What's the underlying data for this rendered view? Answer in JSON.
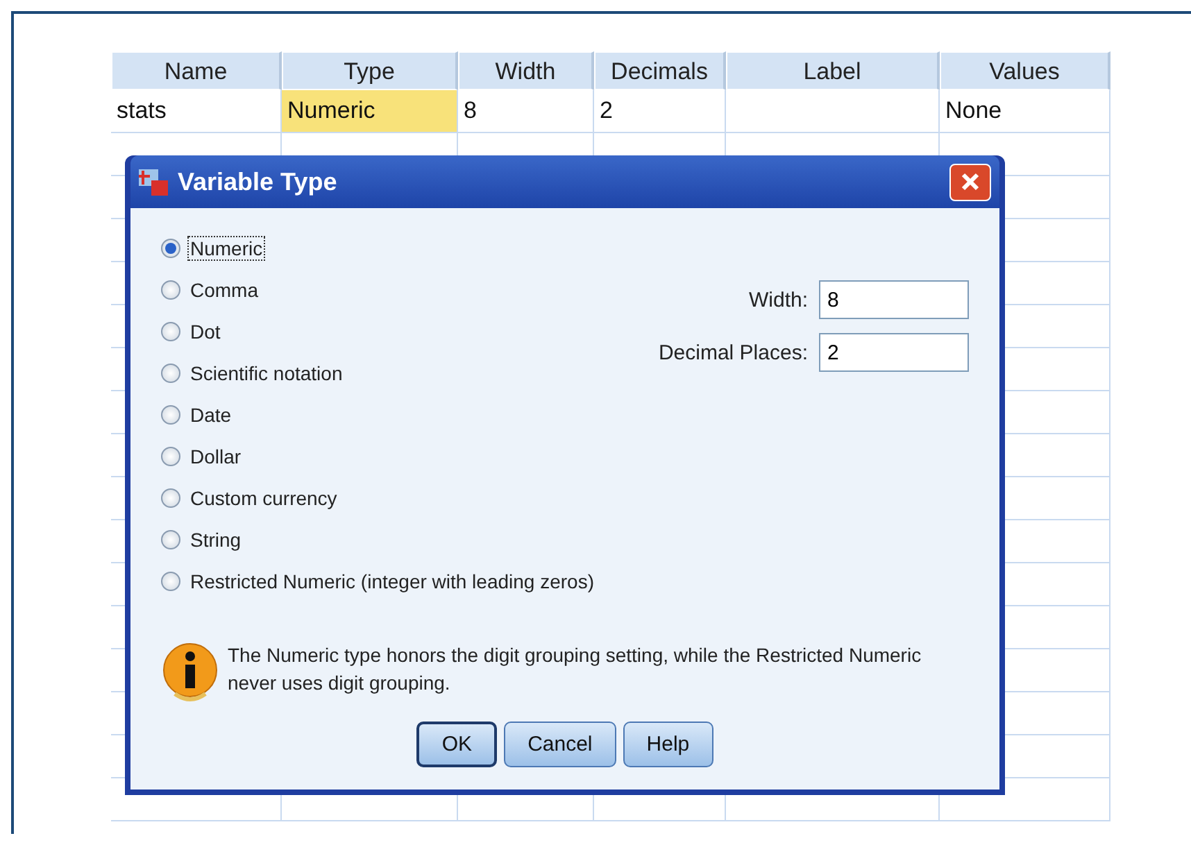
{
  "grid": {
    "columns": [
      "Name",
      "Type",
      "Width",
      "Decimals",
      "Label",
      "Values"
    ],
    "rows": [
      {
        "cells": [
          {
            "text": "stats",
            "selected": false
          },
          {
            "text": "Numeric",
            "selected": true
          },
          {
            "text": "8",
            "selected": false
          },
          {
            "text": "2",
            "selected": false
          },
          {
            "text": "",
            "selected": false
          },
          {
            "text": "None",
            "selected": false
          }
        ]
      }
    ]
  },
  "dialog": {
    "title": "Variable Type",
    "options": [
      {
        "label": "Numeric",
        "selected": true
      },
      {
        "label": "Comma",
        "selected": false
      },
      {
        "label": "Dot",
        "selected": false
      },
      {
        "label": "Scientific notation",
        "selected": false
      },
      {
        "label": "Date",
        "selected": false
      },
      {
        "label": "Dollar",
        "selected": false
      },
      {
        "label": "Custom currency",
        "selected": false
      },
      {
        "label": "String",
        "selected": false
      },
      {
        "label": "Restricted Numeric (integer with leading zeros)",
        "selected": false
      }
    ],
    "fields": [
      {
        "label": "Width:",
        "value": "8"
      },
      {
        "label": "Decimal Places:",
        "value": "2"
      }
    ],
    "info": "The Numeric type honors the digit grouping setting, while the Restricted Numeric never uses digit grouping.",
    "buttons": [
      {
        "label": "OK",
        "default": true
      },
      {
        "label": "Cancel",
        "default": false
      },
      {
        "label": "Help",
        "default": false
      }
    ]
  }
}
